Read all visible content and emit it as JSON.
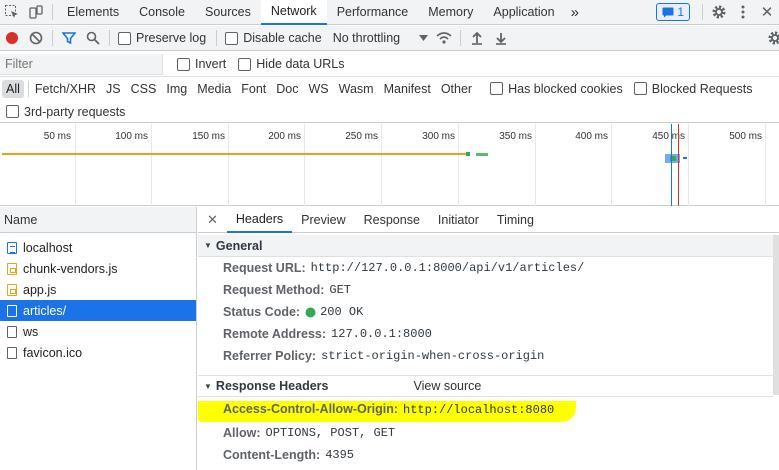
{
  "tabbar": {
    "tabs": [
      "Elements",
      "Console",
      "Sources",
      "Network",
      "Performance",
      "Memory",
      "Application"
    ],
    "active": "Network",
    "more": "»",
    "badge_count": "1"
  },
  "toolbar": {
    "preserve_log": "Preserve log",
    "disable_cache": "Disable cache",
    "throttling": "No throttling"
  },
  "filter": {
    "placeholder": "Filter",
    "invert": "Invert",
    "hide_data_urls": "Hide data URLs"
  },
  "types": {
    "items": [
      "All",
      "Fetch/XHR",
      "JS",
      "CSS",
      "Img",
      "Media",
      "Font",
      "Doc",
      "WS",
      "Wasm",
      "Manifest",
      "Other"
    ],
    "active": "All",
    "blocked_cookies": "Has blocked cookies",
    "blocked_requests": "Blocked Requests",
    "third_party": "3rd-party requests"
  },
  "overview": {
    "ticks": [
      "50 ms",
      "100 ms",
      "150 ms",
      "200 ms",
      "250 ms",
      "300 ms",
      "350 ms",
      "400 ms",
      "450 ms",
      "500 ms"
    ]
  },
  "requests": {
    "header": "Name",
    "items": [
      {
        "name": "localhost",
        "icon": "document-icon"
      },
      {
        "name": "chunk-vendors.js",
        "icon": "script-icon"
      },
      {
        "name": "app.js",
        "icon": "script-icon"
      },
      {
        "name": "articles/",
        "icon": "file-icon"
      },
      {
        "name": "ws",
        "icon": "file-icon"
      },
      {
        "name": "favicon.ico",
        "icon": "file-icon"
      }
    ],
    "selected": "articles/"
  },
  "details": {
    "tabs": [
      "Headers",
      "Preview",
      "Response",
      "Initiator",
      "Timing"
    ],
    "active": "Headers",
    "general": {
      "title": "General",
      "rows": [
        {
          "k": "Request URL:",
          "v": "http://127.0.0.1:8000/api/v1/articles/"
        },
        {
          "k": "Request Method:",
          "v": "GET"
        },
        {
          "k": "Status Code:",
          "v": "200 OK"
        },
        {
          "k": "Remote Address:",
          "v": "127.0.0.1:8000"
        },
        {
          "k": "Referrer Policy:",
          "v": "strict-origin-when-cross-origin"
        }
      ]
    },
    "response": {
      "title": "Response Headers",
      "view_source": "View source",
      "rows": [
        {
          "k": "Access-Control-Allow-Origin:",
          "v": "http://localhost:8080"
        },
        {
          "k": "Allow:",
          "v": "OPTIONS, POST, GET"
        },
        {
          "k": "Content-Length:",
          "v": "4395"
        }
      ]
    }
  },
  "colors": {
    "accent": "#1a73e8",
    "record": "#d93025",
    "status_ok": "#34a853",
    "highlight": "#ffff00"
  }
}
